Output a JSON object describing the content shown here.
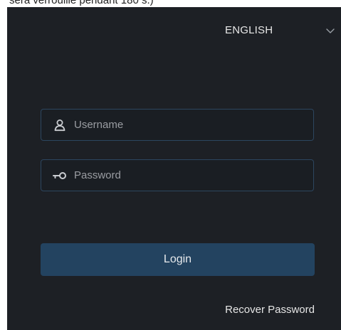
{
  "caption": {
    "text": "sera verrouillé pendant 180 s.)"
  },
  "language": {
    "selected": "ENGLISH",
    "icon": "chevron-down-icon"
  },
  "login_form": {
    "username": {
      "placeholder": "Username",
      "value": "",
      "icon": "user-icon"
    },
    "password": {
      "placeholder": "Password",
      "value": "",
      "icon": "key-icon"
    },
    "login_label": "Login",
    "recover_label": "Recover Password"
  },
  "colors": {
    "panel_background": "#1d2025",
    "field_border": "#2c465f",
    "button_background": "#234360",
    "text": "#e6e6e6",
    "placeholder": "#9a9da2"
  }
}
